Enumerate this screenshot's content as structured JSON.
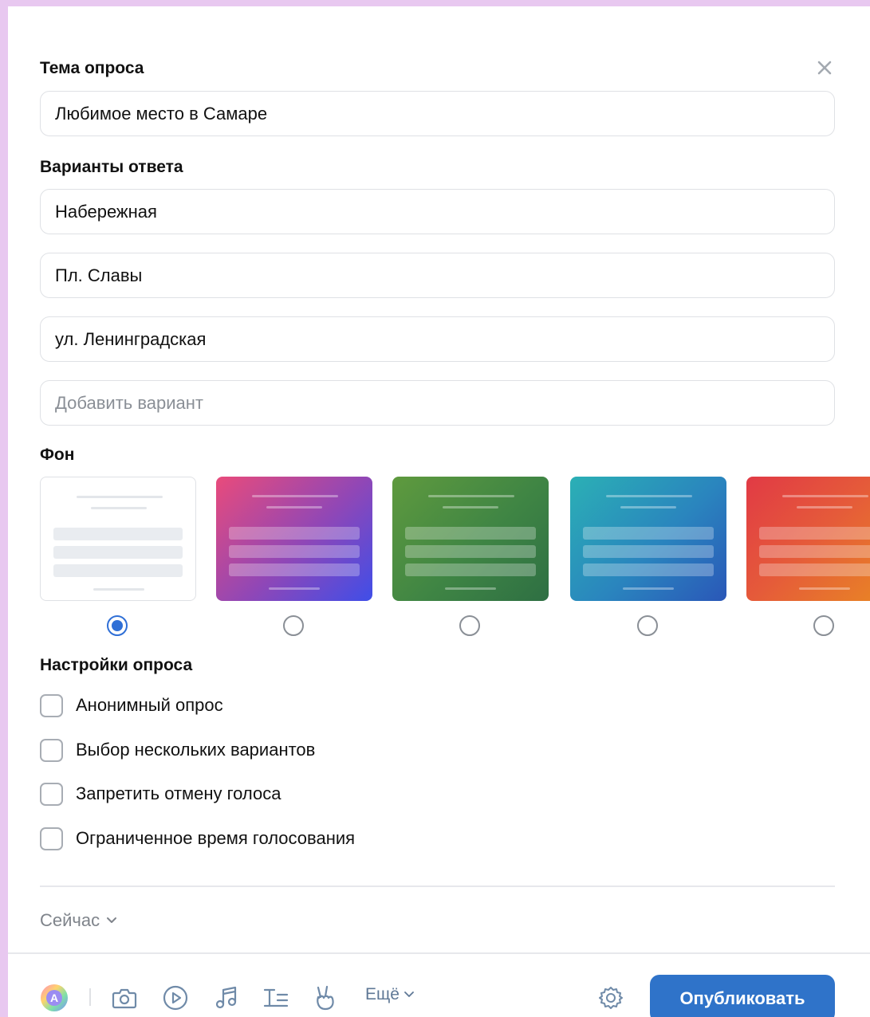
{
  "poll": {
    "topic_label": "Тема опроса",
    "topic_value": "Любимое место в Самаре",
    "options_label": "Варианты ответа",
    "options": [
      "Набережная",
      "Пл. Славы",
      "ул. Ленинградская"
    ],
    "add_option_placeholder": "Добавить вариант",
    "background_label": "Фон",
    "backgrounds": [
      {
        "name": "white",
        "selected": true,
        "colors": [
          "#ffffff",
          "#ffffff"
        ]
      },
      {
        "name": "pink-purple",
        "selected": false,
        "colors": [
          "#e94b7b",
          "#3f4ee8"
        ]
      },
      {
        "name": "green",
        "selected": false,
        "colors": [
          "#5f9a3e",
          "#2e6f43"
        ]
      },
      {
        "name": "teal-blue",
        "selected": false,
        "colors": [
          "#2bb0b5",
          "#2a57b8"
        ]
      },
      {
        "name": "red-orange",
        "selected": false,
        "colors": [
          "#e13a45",
          "#e98a22"
        ]
      }
    ],
    "settings_label": "Настройки опроса",
    "settings": [
      {
        "label": "Анонимный опрос",
        "checked": false
      },
      {
        "label": "Выбор нескольких вариантов",
        "checked": false
      },
      {
        "label": "Запретить отмену голоса",
        "checked": false
      },
      {
        "label": "Ограниченное время голосования",
        "checked": false
      }
    ]
  },
  "footer": {
    "when_label": "Сейчас",
    "more_label": "Ещё",
    "publish_label": "Опубликовать"
  },
  "icons": {
    "close": "close-icon",
    "author": "author-avatar-icon",
    "photo": "camera-icon",
    "video": "play-icon",
    "music": "music-note-icon",
    "text": "text-format-icon",
    "sticker": "peace-hand-icon",
    "settings": "gear-icon"
  },
  "colors": {
    "accent": "#2f73c9",
    "radio_selected": "#2f6fd6",
    "page_background": "#e8c8f0"
  }
}
